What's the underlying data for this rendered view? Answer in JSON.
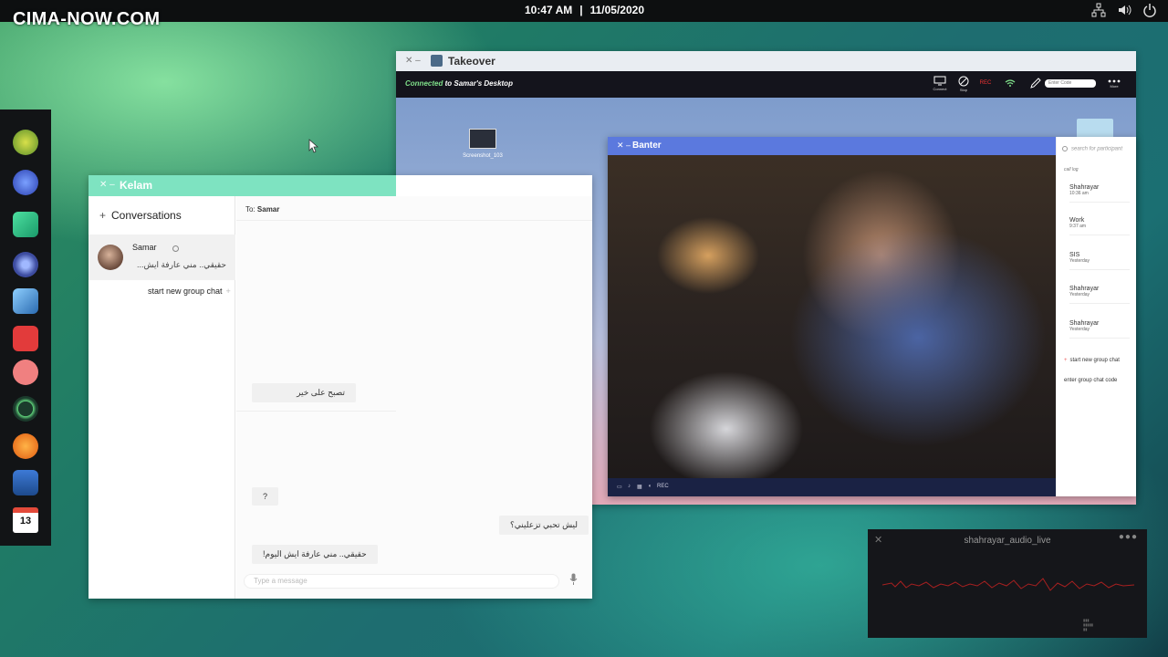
{
  "desktop": {
    "logo_text": "CIMA-NOW.COM",
    "time": "10:47 AM",
    "date": "11/05/2020",
    "tray_icons": [
      "network-icon",
      "volume-icon",
      "power-icon"
    ],
    "dock_icons": [
      "leaf-app-icon",
      "lightning-app-icon",
      "mail-app-icon",
      "camera-app-icon",
      "dice-app-icon",
      "lock-app-icon",
      "audio-app-icon",
      "time-app-icon",
      "planet-app-icon",
      "document-app-icon",
      "calendar-app-icon"
    ],
    "calendar_day": "13"
  },
  "kelam": {
    "title": "Kelam",
    "conversations_label": "Conversations",
    "conversation": {
      "name": "Samar",
      "preview": "حقيقي.. مني عارفة ايش..."
    },
    "new_group_label": "start new group chat",
    "to_label": "To:",
    "to_name": "Samar",
    "messages": [
      {
        "text": "تصبح على خير"
      },
      {
        "text": "?"
      },
      {
        "text": "ليش تحبي تزعليني؟"
      },
      {
        "text": "حقيقي.. مني عارفة ايش اليوم!"
      }
    ],
    "composer_placeholder": "Type a message"
  },
  "takeover": {
    "title": "Takeover",
    "status_connected": "Connected",
    "status_rest": "to Samar's Desktop",
    "tools": [
      {
        "label": "Connect"
      },
      {
        "label": "Stop"
      },
      {
        "label": "REC"
      },
      {
        "label": ""
      }
    ],
    "enter_code_placeholder": "Enter Code",
    "more_label": "More",
    "desktop_file": "Screenshot_103"
  },
  "banter": {
    "title": "Banter",
    "search_placeholder": "search for participant",
    "call_log_label": "call log",
    "log": [
      {
        "name": "Shahrayar",
        "time": "10:36 am"
      },
      {
        "name": "Work",
        "time": "9:37 am"
      },
      {
        "name": "SIS",
        "time": "Yesterday"
      },
      {
        "name": "Shahrayar",
        "time": "Yesterday"
      },
      {
        "name": "Shahrayar",
        "time": "Yesterday"
      }
    ],
    "new_group_label": "start new group chat",
    "enter_code_label": "enter group chat code",
    "rec_label": "REC"
  },
  "audio": {
    "title": "shahrayar_audio_live"
  },
  "colors": {
    "kelam_accent": "#7ee3c1",
    "banter_accent": "#5b79de",
    "rec_red": "#e33333",
    "connected_green": "#7fe08a"
  }
}
